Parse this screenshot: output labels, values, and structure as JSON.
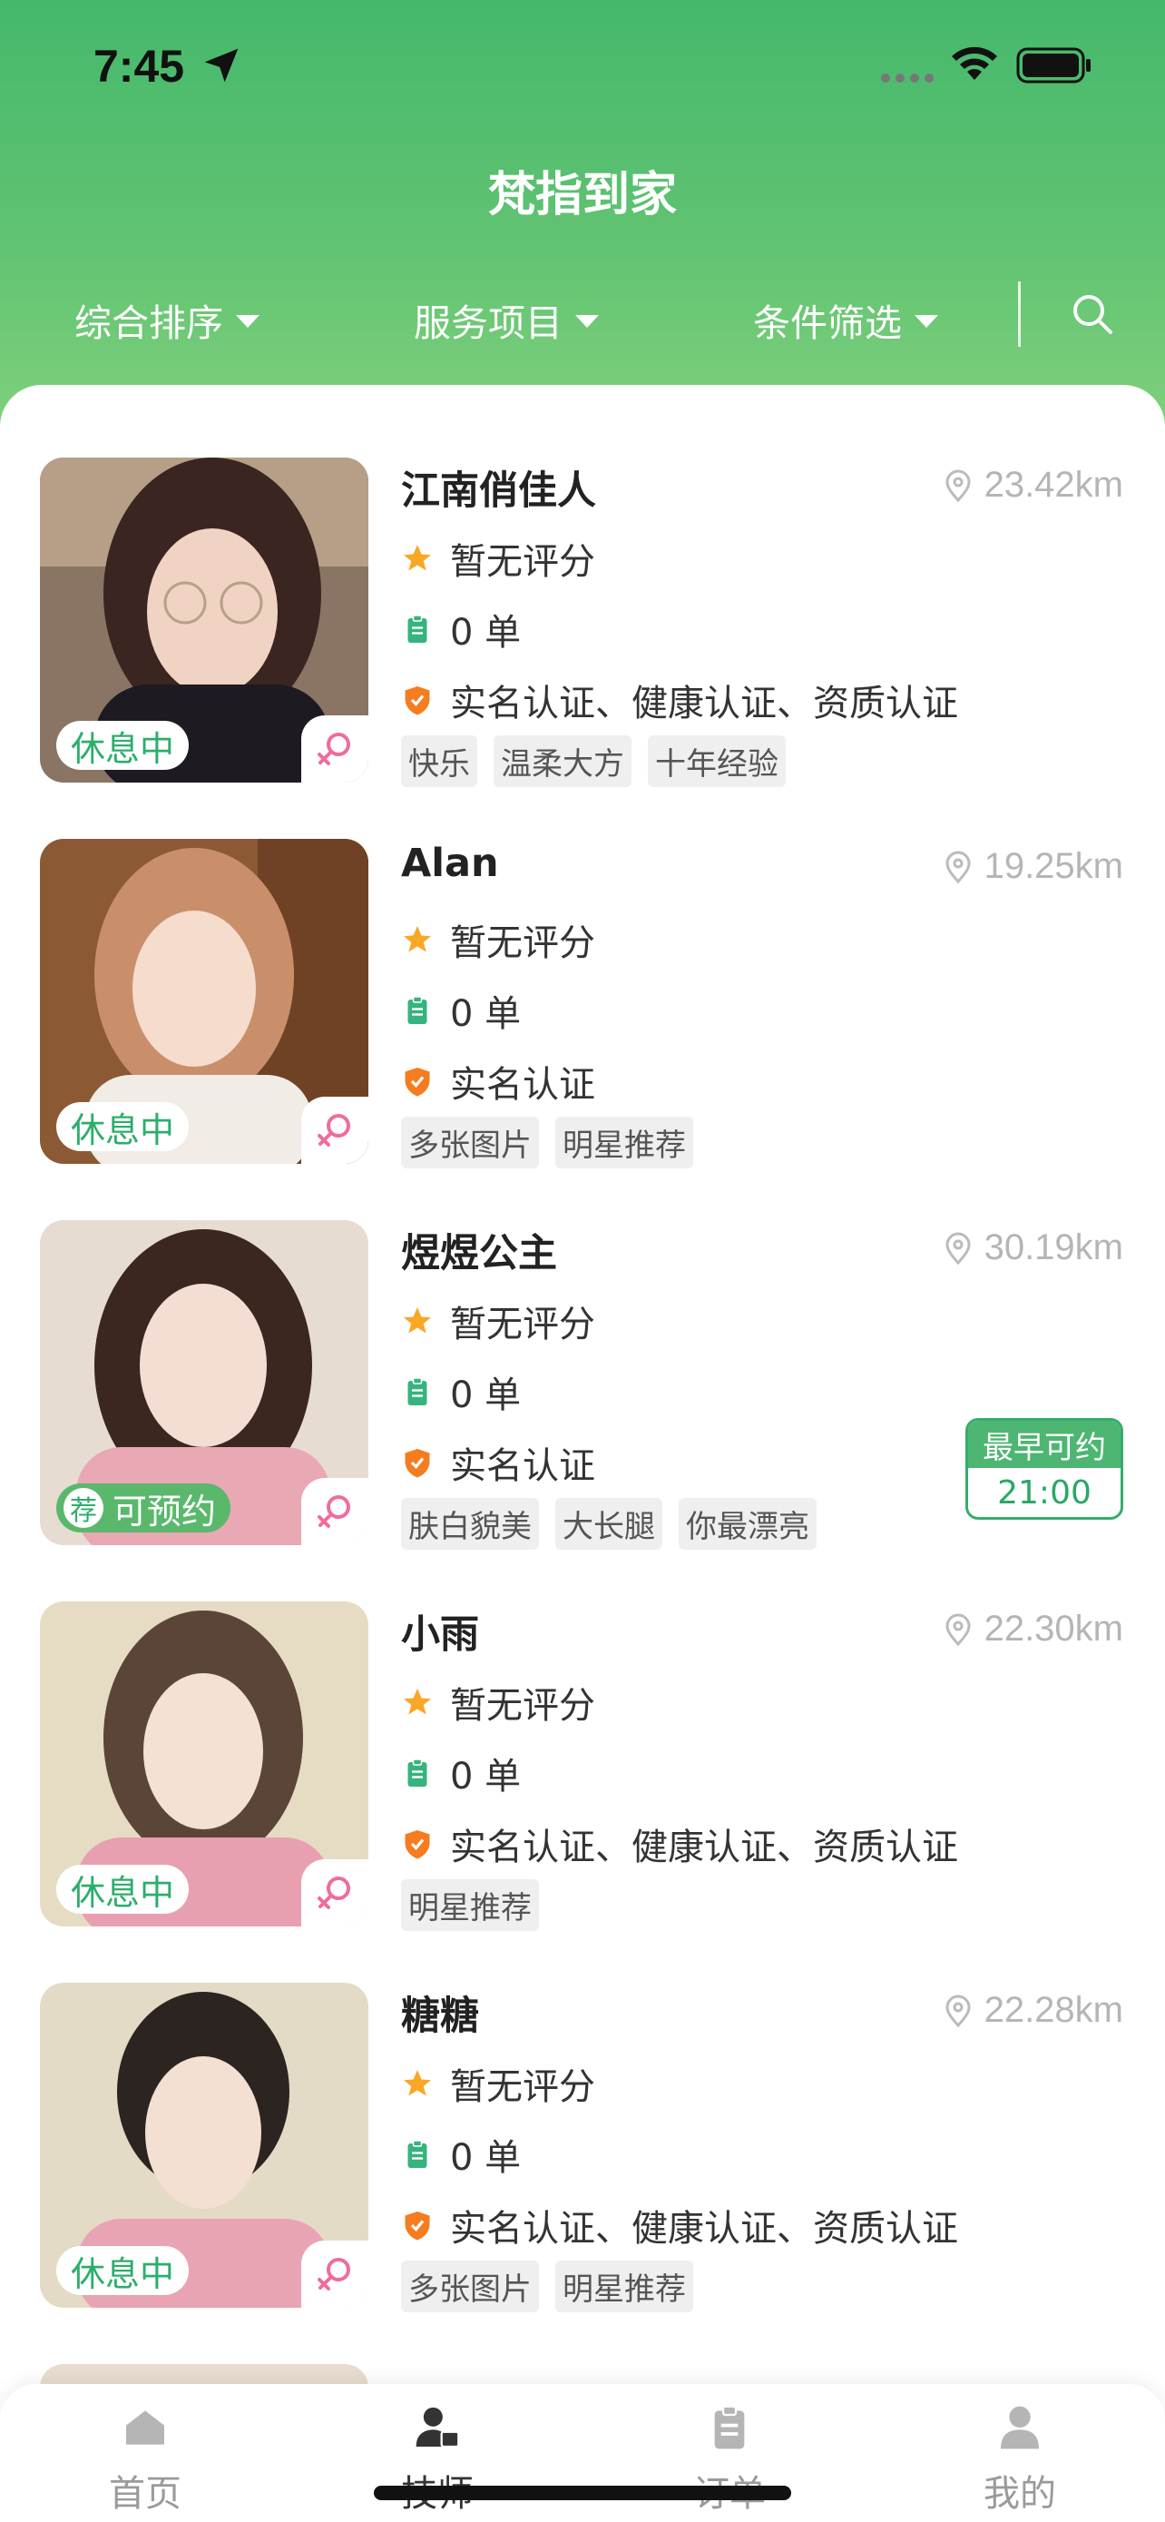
{
  "status_bar": {
    "time": "7:45"
  },
  "app_title": "梵指到家",
  "filters": [
    {
      "label": "综合排序"
    },
    {
      "label": "服务项目"
    },
    {
      "label": "条件筛选"
    }
  ],
  "colors": {
    "accent": "#45b86c",
    "tag_bg": "#efefef",
    "distance": "#b5b5b5"
  },
  "therapists": [
    {
      "name": "江南俏佳人",
      "distance": "23.42km",
      "rating": "暂无评分",
      "orders": "0 单",
      "certs": "实名认证、健康认证、资质认证",
      "status": "休息中",
      "tags": [
        "快乐",
        "温柔大方",
        "十年经验"
      ]
    },
    {
      "name": "Alan",
      "distance": "19.25km",
      "rating": "暂无评分",
      "orders": "0 单",
      "certs": "实名认证",
      "status": "休息中",
      "tags": [
        "多张图片",
        "明星推荐"
      ]
    },
    {
      "name": "煜煜公主",
      "distance": "30.19km",
      "rating": "暂无评分",
      "orders": "0 单",
      "certs": "实名认证",
      "status": "可预约",
      "recommend_mark": "荐",
      "earliest_label": "最早可约",
      "earliest_time": "21:00",
      "tags": [
        "肤白貌美",
        "大长腿",
        "你最漂亮"
      ]
    },
    {
      "name": "小雨",
      "distance": "22.30km",
      "rating": "暂无评分",
      "orders": "0 单",
      "certs": "实名认证、健康认证、资质认证",
      "status": "休息中",
      "tags": [
        "明星推荐"
      ]
    },
    {
      "name": "糖糖",
      "distance": "22.28km",
      "rating": "暂无评分",
      "orders": "0 单",
      "certs": "实名认证、健康认证、资质认证",
      "status": "休息中",
      "tags": [
        "多张图片",
        "明星推荐"
      ]
    }
  ],
  "tabbar": [
    {
      "label": "首页",
      "icon": "home-icon"
    },
    {
      "label": "技师",
      "icon": "technician-icon"
    },
    {
      "label": "订单",
      "icon": "order-icon"
    },
    {
      "label": "我的",
      "icon": "profile-icon"
    }
  ]
}
